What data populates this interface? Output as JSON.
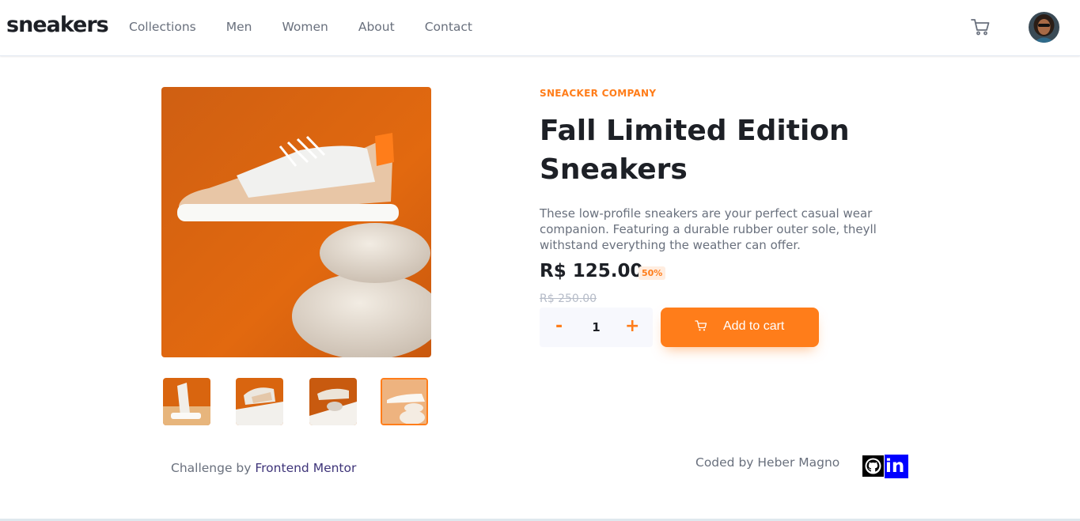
{
  "header": {
    "logo": "sneakers",
    "nav": [
      "Collections",
      "Men",
      "Women",
      "About",
      "Contact"
    ],
    "cart_icon": "cart-icon",
    "avatar_icon": "avatar"
  },
  "product": {
    "company": "SNEACKER COMPANY",
    "title": "Fall Limited Edition Sneakers",
    "description": "These low-profile sneakers are your perfect casual wear companion. Featuring a durable rubber outer sole, theyll withstand everything the weather can offer.",
    "price": "R$ 125.00",
    "discount": "50%",
    "old_price": "R$ 250.00",
    "quantity": "1",
    "minus_label": "-",
    "plus_label": "+",
    "add_to_cart_label": "Add to cart",
    "active_thumbnail": 4
  },
  "footer": {
    "challenge_prefix": "Challenge by ",
    "challenge_link": "Frontend Mentor",
    "coded_by": "Coded by Heber Magno",
    "linkedin_label": "in"
  },
  "colors": {
    "accent": "#ff7d1a",
    "text_dark": "#1d2026",
    "text_gray": "#69707d",
    "linkedin_bg": "#0000ff"
  }
}
